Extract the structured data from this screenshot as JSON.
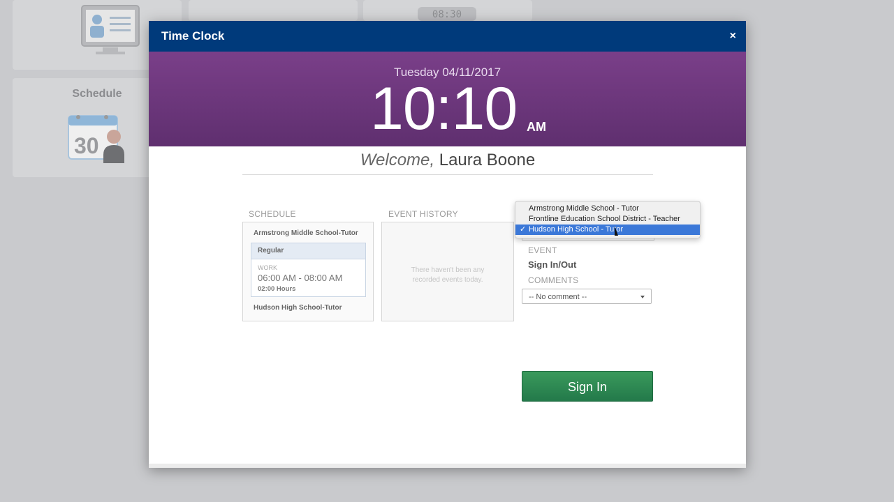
{
  "background": {
    "schedule_tile_label": "Schedule",
    "calendar_day": "30",
    "clock_pill": "08:30"
  },
  "modal": {
    "title": "Time Clock",
    "close_label": "×"
  },
  "clock": {
    "date": "Tuesday 04/11/2017",
    "time": "10:10",
    "ampm": "AM"
  },
  "welcome": {
    "greeting": "Welcome,",
    "name": "Laura Boone"
  },
  "schedule": {
    "label": "SCHEDULE",
    "site_1": "Armstrong Middle School-Tutor",
    "card": {
      "type": "Regular",
      "work_label": "WORK",
      "time_range": "06:00 AM - 08:00 AM",
      "hours": "02:00 Hours"
    },
    "site_2": "Hudson High School-Tutor"
  },
  "event_history": {
    "label": "EVENT HISTORY",
    "empty_message": "There haven't been any recorded events today."
  },
  "position_dropdown": {
    "options": [
      "Armstrong Middle School - Tutor",
      "Frontline Education School District - Teacher",
      "Hudson High School - Tutor"
    ],
    "selected_index": 2,
    "check_mark": "✓"
  },
  "event": {
    "label": "EVENT",
    "value": "Sign In/Out"
  },
  "comments": {
    "label": "COMMENTS",
    "selected": "-- No comment --"
  },
  "signin": {
    "label": "Sign In"
  },
  "colors": {
    "header": "#003a7b",
    "banner": "#6a3579",
    "signin_button": "#2e8b57",
    "selected_option": "#3b78d8"
  }
}
